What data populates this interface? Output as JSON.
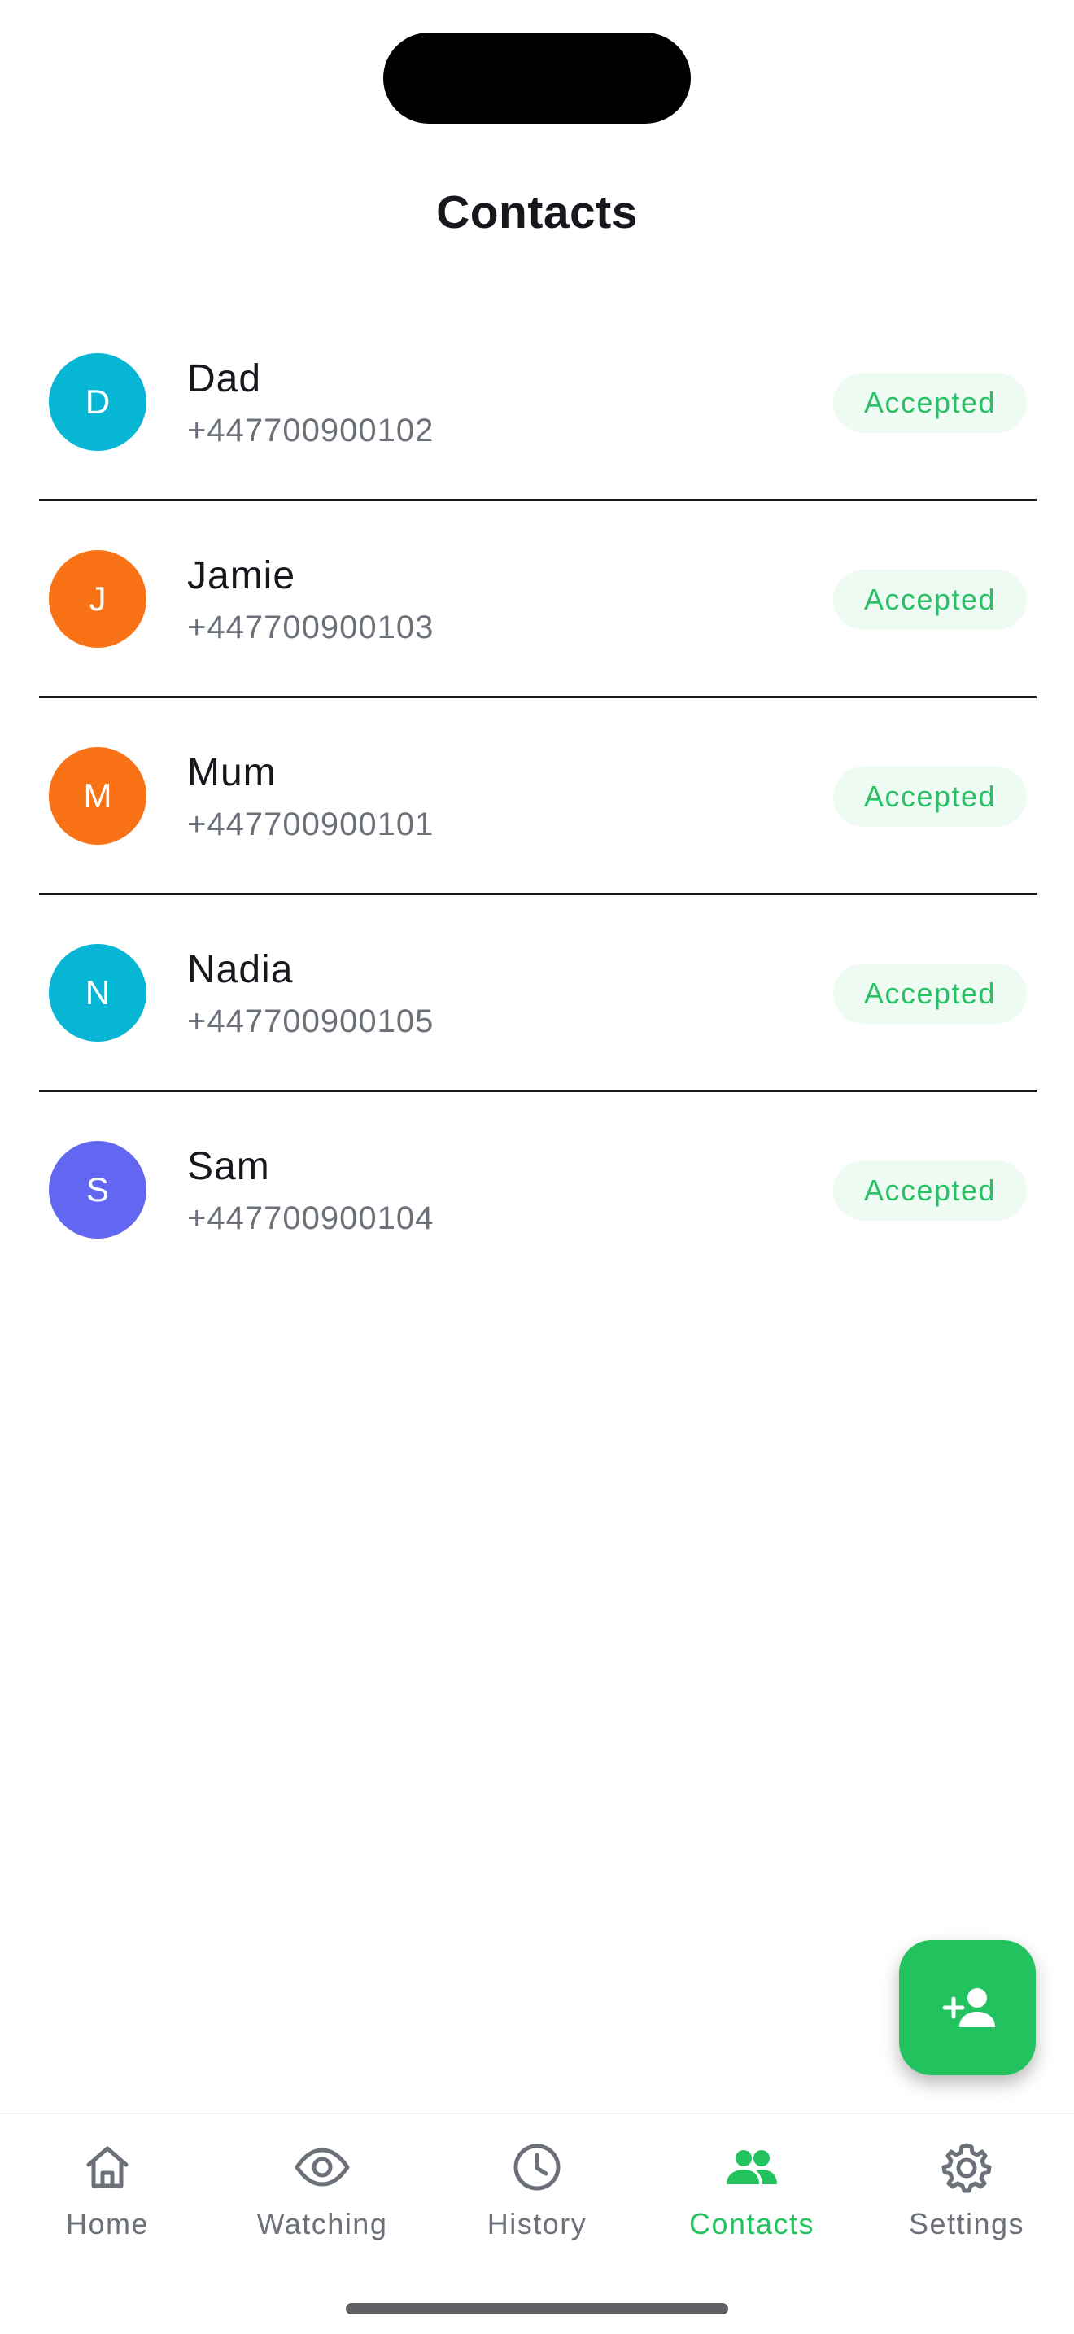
{
  "page": {
    "title": "Contacts"
  },
  "contacts": [
    {
      "initial": "D",
      "name": "Dad",
      "phone": "+447700900102",
      "status": "Accepted",
      "avatar_color": "#06b6d4"
    },
    {
      "initial": "J",
      "name": "Jamie",
      "phone": "+447700900103",
      "status": "Accepted",
      "avatar_color": "#f97316"
    },
    {
      "initial": "M",
      "name": "Mum",
      "phone": "+447700900101",
      "status": "Accepted",
      "avatar_color": "#f97316"
    },
    {
      "initial": "N",
      "name": "Nadia",
      "phone": "+447700900105",
      "status": "Accepted",
      "avatar_color": "#06b6d4"
    },
    {
      "initial": "S",
      "name": "Sam",
      "phone": "+447700900104",
      "status": "Accepted",
      "avatar_color": "#6366f1"
    }
  ],
  "fab": {
    "icon": "person-add-icon"
  },
  "tabs": [
    {
      "label": "Home",
      "icon": "home-icon"
    },
    {
      "label": "Watching",
      "icon": "eye-icon"
    },
    {
      "label": "History",
      "icon": "clock-icon"
    },
    {
      "label": "Contacts",
      "icon": "people-icon",
      "active": true
    },
    {
      "label": "Settings",
      "icon": "gear-icon"
    }
  ],
  "colors": {
    "accent": "#22c35e",
    "status_text": "#2ac066",
    "status_bg": "#eefbf3",
    "inactive_tab": "#6b7079",
    "title_text": "#16181d"
  }
}
